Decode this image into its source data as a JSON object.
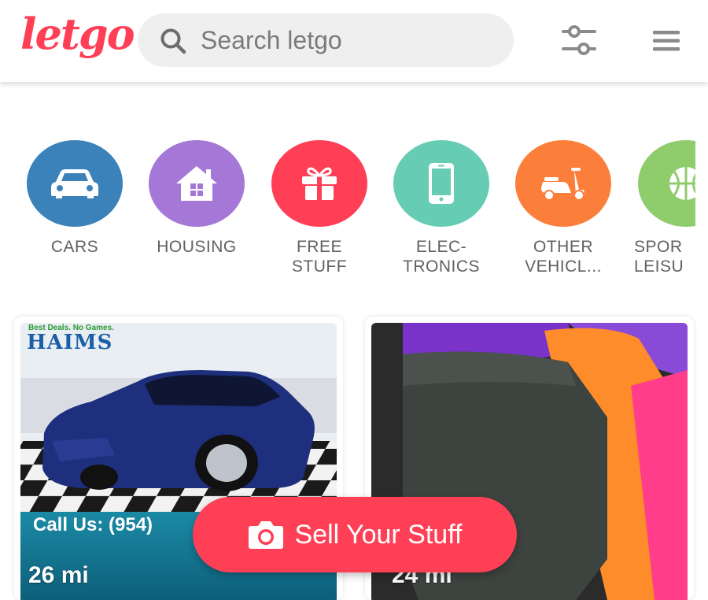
{
  "header": {
    "logo": "letgo",
    "search_placeholder": "Search letgo"
  },
  "categories": [
    {
      "label": "CARS",
      "color": "#3a82b9",
      "icon": "car-icon"
    },
    {
      "label": "HOUSING",
      "color": "#a578d8",
      "icon": "house-icon"
    },
    {
      "label": "FREE\nSTUFF",
      "color": "#ff3f55",
      "icon": "gift-icon"
    },
    {
      "label": "ELEC-\nTRONICS",
      "color": "#66cdb4",
      "icon": "phone-icon"
    },
    {
      "label": "OTHER\nVEHICL...",
      "color": "#fb7f3a",
      "icon": "scooter-icon"
    },
    {
      "label": "SPOR\nLEISU",
      "color": "#8fcc6c",
      "icon": "ball-icon"
    }
  ],
  "listings": [
    {
      "distance": "26 mi",
      "overlay_text": "Call Us: (954)",
      "brand_text": "HAIMS",
      "brand_tagline": "Best Deals. No Games."
    },
    {
      "distance": "24 mi"
    }
  ],
  "sell_button": {
    "label": "Sell Your Stuff",
    "icon": "camera-icon"
  }
}
